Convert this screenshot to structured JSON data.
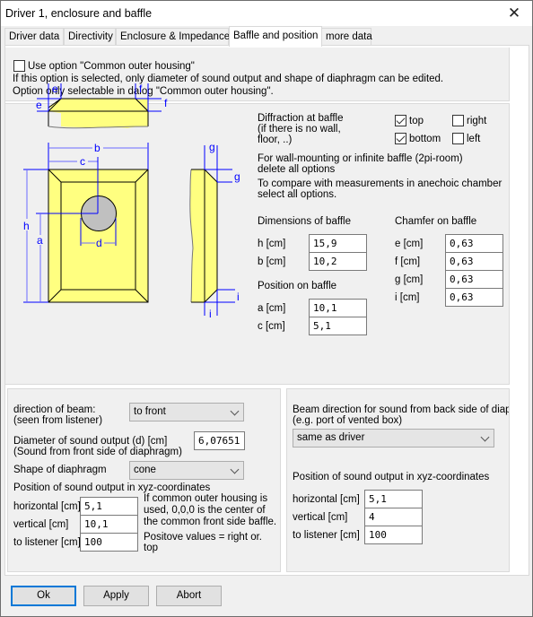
{
  "window": {
    "title": "Driver 1, enclosure and baffle",
    "close_label": "✕"
  },
  "tabs": [
    {
      "label": "Driver data",
      "active": false
    },
    {
      "label": "Directivity",
      "active": false
    },
    {
      "label": "Enclosure & Impedance",
      "active": false
    },
    {
      "label": "Baffle and position",
      "active": true
    },
    {
      "label": "more data",
      "active": false
    }
  ],
  "housing": {
    "checkbox_label": "Use option \"Common outer housing\"",
    "checked": false,
    "info_line1": "If this option is selected, only diameter of sound output and shape of diaphragm can be edited.",
    "info_line2": "Option only selectable in dalog \"Common outer housing\"."
  },
  "diagram": {
    "labels": {
      "e": "e",
      "f": "f",
      "b": "b",
      "c": "c",
      "g": "g",
      "h": "h",
      "a": "a",
      "d": "d",
      "i": "i"
    },
    "colors": {
      "baffle_fill": "#ffff80",
      "dimension_line": "#0000ff",
      "dimension_line_light": "#6a6aff",
      "diaphragm_fill": "#c0c0c0"
    }
  },
  "diffraction": {
    "title_line1": "Diffraction at baffle",
    "title_line2": "(if there is no wall,",
    "title_line3": "floor, ..)",
    "options": {
      "top": {
        "label": "top",
        "checked": true
      },
      "right": {
        "label": "right",
        "checked": false
      },
      "bottom": {
        "label": "bottom",
        "checked": true
      },
      "left": {
        "label": "left",
        "checked": false
      }
    },
    "note1_line1": "For wall-mounting or infinite baffle (2pi-room)",
    "note1_line2": "delete all options",
    "note2_line1": "To compare with measurements in anechoic chamber",
    "note2_line2": "select all options."
  },
  "dimensions": {
    "title": "Dimensions of baffle",
    "h_label": "h [cm]",
    "h_value": "15,9",
    "b_label": "b [cm]",
    "b_value": "10,2"
  },
  "position_on_baffle": {
    "title": "Position on baffle",
    "a_label": "a [cm]",
    "a_value": "10,1",
    "c_label": "c [cm]",
    "c_value": "5,1"
  },
  "chamfer": {
    "title": "Chamfer on baffle",
    "e_label": "e [cm]",
    "e_value": "0,63",
    "f_label": "f [cm]",
    "f_value": "0,63",
    "g_label": "g [cm]",
    "g_value": "0,63",
    "i_label": "i [cm]",
    "i_value": "0,63"
  },
  "front": {
    "beam_label_line1": "direction of beam:",
    "beam_label_line2": "(seen from listener)",
    "beam_value": "to front",
    "diameter_label_line1": "Diameter of sound output (d) [cm]",
    "diameter_label_line2": "(Sound from front side of diaphragm)",
    "diameter_value": "6,07651",
    "shape_label": "Shape of diaphragm",
    "shape_value": "cone",
    "position_title": "Position of sound output in xyz-coordinates",
    "horizontal_label": "horizontal [cm]",
    "horizontal_value": "5,1",
    "vertical_label": "vertical [cm]",
    "vertical_value": "10,1",
    "listener_label": "to listener [cm]",
    "listener_value": "100",
    "note1_line1": "If common outer housing is",
    "note1_line2": "used, 0,0,0 is the center of",
    "note1_line3": "the common front side baffle.",
    "note2_line1": "Positove values = right or.",
    "note2_line2": "top"
  },
  "back": {
    "beam_label_line1": "Beam direction for sound from back side of diaphra",
    "beam_label_line2": "(e.g. port of vented box)",
    "beam_value": "same as driver",
    "position_title": "Position of sound output in xyz-coordinates",
    "horizontal_label": "horizontal [cm]",
    "horizontal_value": "5,1",
    "vertical_label": "vertical [cm]",
    "vertical_value": "4",
    "listener_label": "to listener [cm]",
    "listener_value": "100"
  },
  "buttons": {
    "ok": "Ok",
    "apply": "Apply",
    "abort": "Abort"
  }
}
